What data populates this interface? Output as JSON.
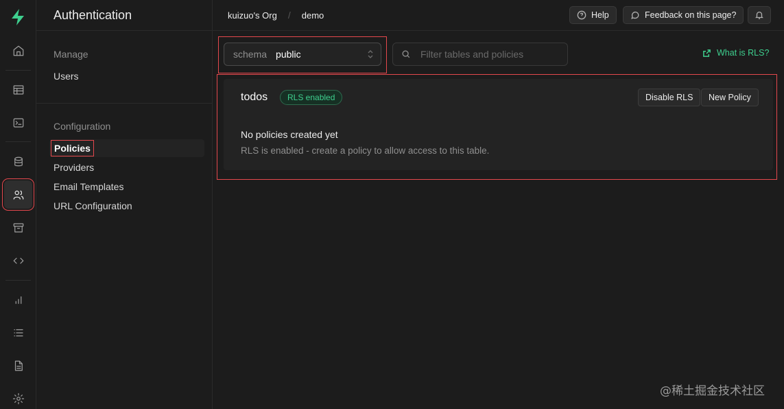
{
  "rail": {
    "items": [
      {
        "name": "home-icon"
      },
      {
        "name": "table-editor-icon"
      },
      {
        "name": "sql-editor-icon"
      },
      {
        "name": "database-icon"
      },
      {
        "name": "authentication-icon"
      },
      {
        "name": "storage-icon"
      },
      {
        "name": "edge-functions-icon"
      },
      {
        "name": "reports-icon"
      },
      {
        "name": "logs-icon"
      },
      {
        "name": "api-docs-icon"
      },
      {
        "name": "settings-icon"
      }
    ],
    "active": "authentication-icon"
  },
  "sidebar": {
    "title": "Authentication",
    "groups": [
      {
        "label": "Manage",
        "items": [
          "Users"
        ]
      },
      {
        "label": "Configuration",
        "items": [
          "Policies",
          "Providers",
          "Email Templates",
          "URL Configuration"
        ]
      }
    ],
    "active_item": "Policies"
  },
  "topbar": {
    "org": "kuizuo's Org",
    "separator": "/",
    "project": "demo",
    "help_label": "Help",
    "feedback_label": "Feedback on this page?"
  },
  "toolbar": {
    "schema_label": "schema",
    "schema_value": "public",
    "filter_placeholder": "Filter tables and policies",
    "whatis_label": "What is RLS?"
  },
  "policy_panel": {
    "table_name": "todos",
    "badge": "RLS enabled",
    "disable_label": "Disable RLS",
    "new_policy_label": "New Policy",
    "empty_title": "No policies created yet",
    "empty_desc": "RLS is enabled - create a policy to allow access to this table."
  },
  "watermark": "@稀土掘金技术社区",
  "colors": {
    "accent": "#3ecf8e",
    "highlight": "#e5484d",
    "background": "#1c1c1c"
  }
}
